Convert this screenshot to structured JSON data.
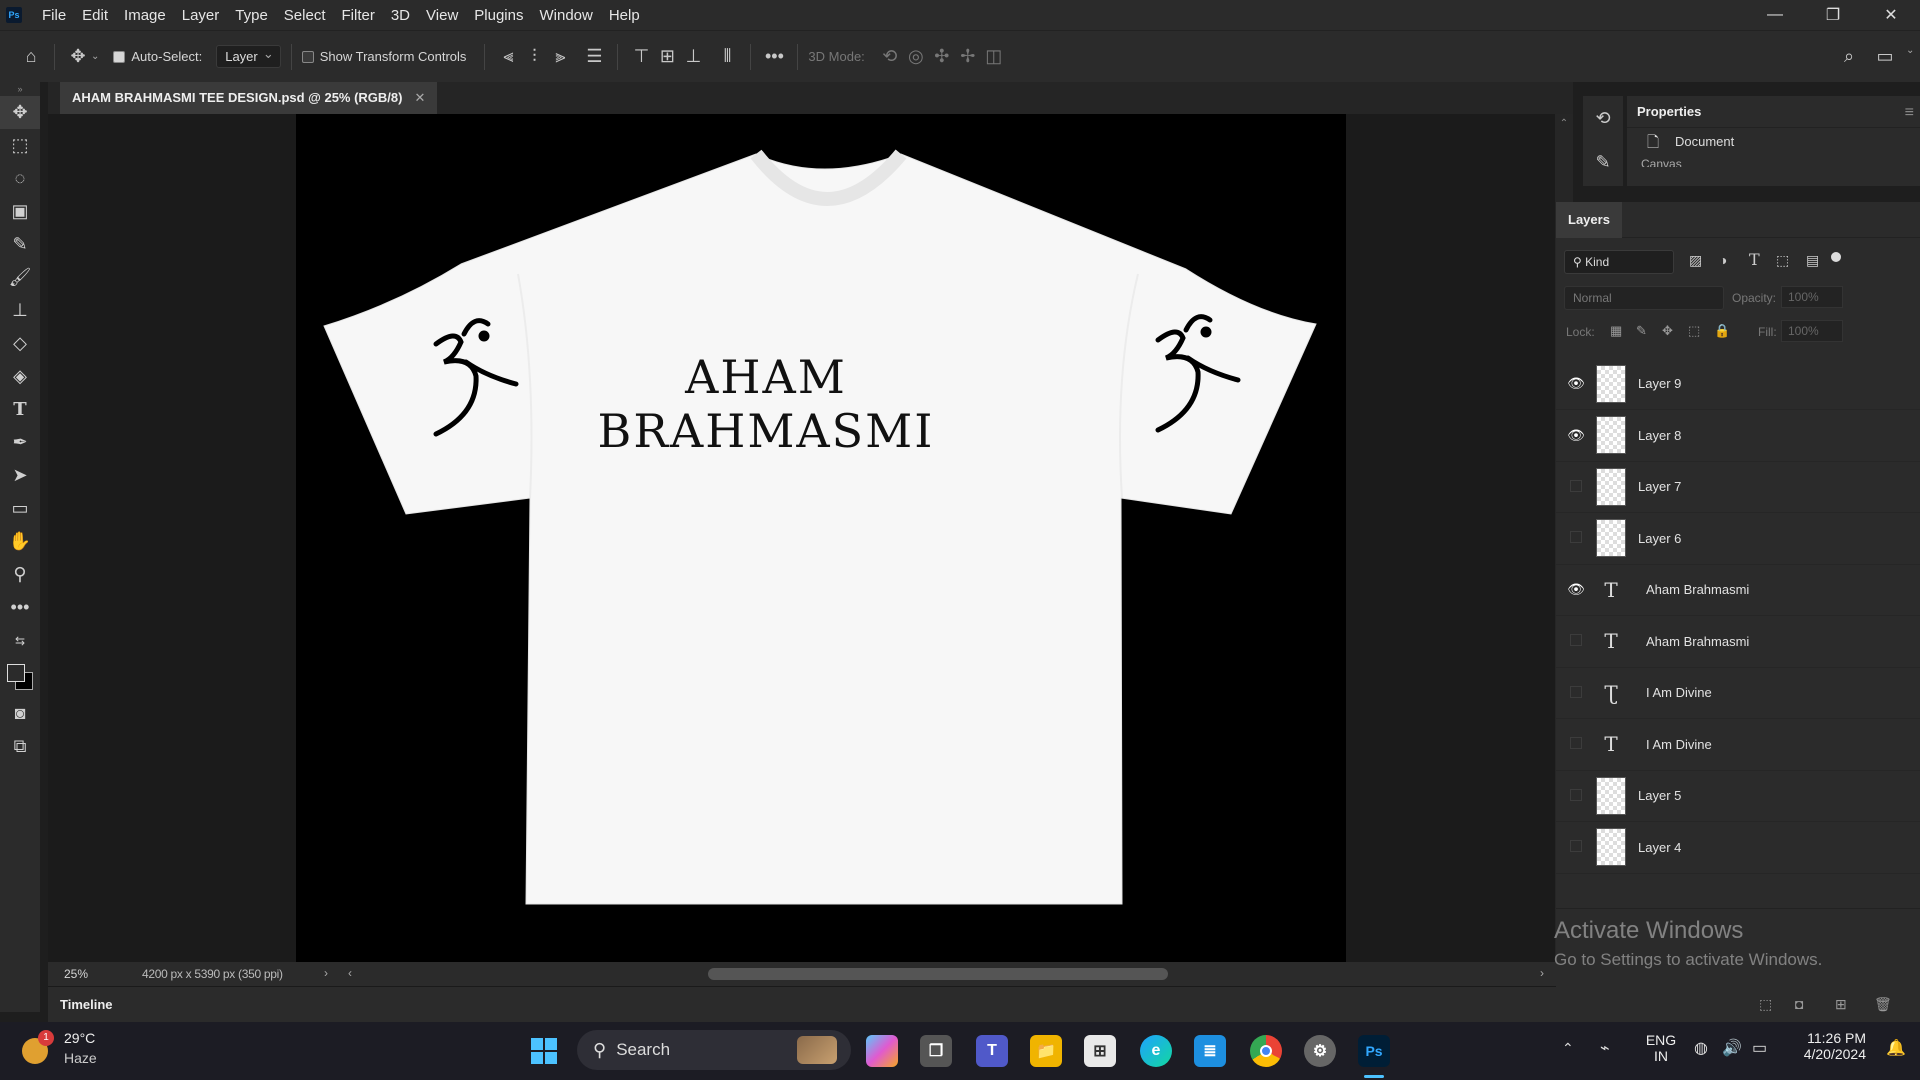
{
  "menubar": {
    "app_badge": "Ps",
    "items": [
      "File",
      "Edit",
      "Image",
      "Layer",
      "Type",
      "Select",
      "Filter",
      "3D",
      "View",
      "Plugins",
      "Window",
      "Help"
    ]
  },
  "options": {
    "auto_select_label": "Auto-Select:",
    "auto_select_value": "Layer",
    "transform_label": "Show Transform Controls",
    "mode_3d_label": "3D Mode:"
  },
  "document": {
    "tab_title": "AHAM BRAHMASMI TEE DESIGN.psd @ 25% (RGB/8)",
    "zoom": "25%",
    "dimensions": "4200 px x 5390 px (350 ppi)",
    "design_text": "AHAM BRAHMASMI"
  },
  "timeline": {
    "label": "Timeline"
  },
  "properties": {
    "title": "Properties",
    "document_label": "Document",
    "canvas_label": "Canvas"
  },
  "layers_panel": {
    "title": "Layers",
    "kind_label": "Kind",
    "blend_mode": "Normal",
    "opacity_label": "Opacity:",
    "opacity_value": "100%",
    "lock_label": "Lock:",
    "fill_label": "Fill:",
    "fill_value": "100%",
    "layers": [
      {
        "name": "Layer 9",
        "visible": true,
        "type": "pixel"
      },
      {
        "name": "Layer 8",
        "visible": true,
        "type": "pixel"
      },
      {
        "name": "Layer 7",
        "visible": false,
        "type": "pixel"
      },
      {
        "name": "Layer 6",
        "visible": false,
        "type": "pixel"
      },
      {
        "name": "Aham Brahmasmi",
        "visible": true,
        "type": "text"
      },
      {
        "name": "Aham Brahmasmi",
        "visible": false,
        "type": "text"
      },
      {
        "name": "I Am Divine",
        "visible": false,
        "type": "text-warp"
      },
      {
        "name": "I Am Divine",
        "visible": false,
        "type": "text"
      },
      {
        "name": "Layer 5",
        "visible": false,
        "type": "pixel"
      },
      {
        "name": "Layer 4",
        "visible": false,
        "type": "pixel"
      }
    ]
  },
  "watermark": {
    "line1": "Activate Windows",
    "line2": "Go to Settings to activate Windows."
  },
  "taskbar": {
    "weather_temp": "29°C",
    "weather_desc": "Haze",
    "weather_badge": "1",
    "search_placeholder": "Search",
    "lang_line1": "ENG",
    "lang_line2": "IN",
    "time": "11:26 PM",
    "date": "4/20/2024"
  },
  "colors": {
    "accent": "#31a8ff",
    "panel": "#2b2b2b",
    "canvas_bg": "#000000"
  }
}
